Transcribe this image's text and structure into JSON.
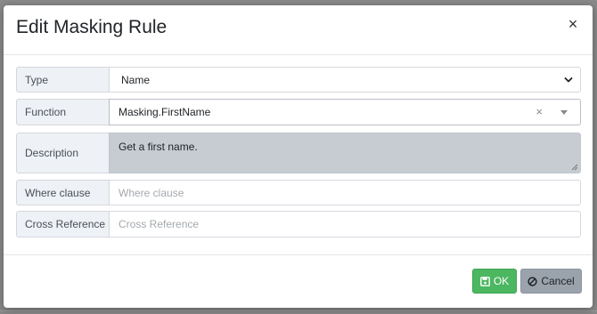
{
  "dialog": {
    "title": "Edit Masking Rule",
    "close_label": "×"
  },
  "form": {
    "type": {
      "label": "Type",
      "value": "Name"
    },
    "function": {
      "label": "Function",
      "value": "Masking.FirstName",
      "clear_label": "×"
    },
    "description": {
      "label": "Description",
      "value": "Get a first name."
    },
    "where_clause": {
      "label": "Where clause",
      "placeholder": "Where clause"
    },
    "cross_reference": {
      "label": "Cross Reference",
      "placeholder": "Cross Reference"
    }
  },
  "footer": {
    "ok_label": "OK",
    "cancel_label": "Cancel"
  },
  "colors": {
    "ok_button": "#4cb761",
    "cancel_button": "#9aa3ab",
    "description_bg": "#c6ccd2",
    "label_bg": "#eef1f5"
  },
  "icons": {
    "ok": "save-icon",
    "cancel": "ban-icon",
    "type_dropdown": "chevron-down-icon",
    "function_dropdown": "caret-down-icon"
  }
}
